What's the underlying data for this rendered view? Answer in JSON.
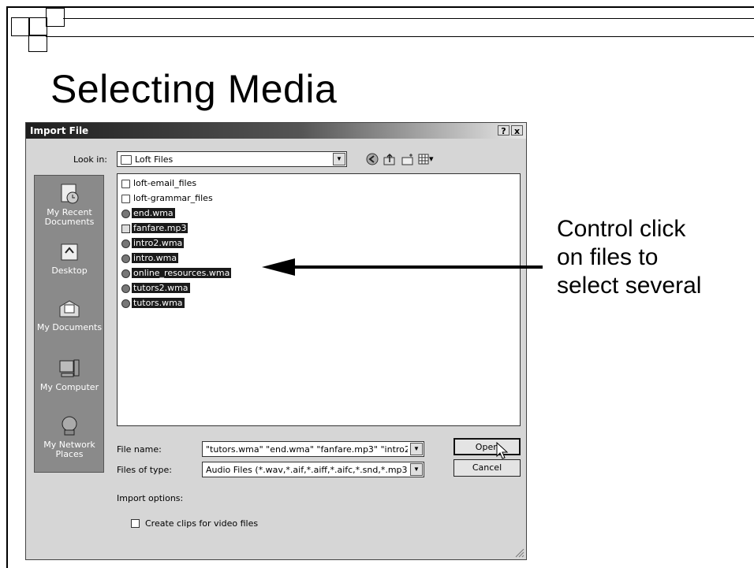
{
  "slide": {
    "title": "Selecting Media",
    "annotation_lines": [
      "Control click",
      "on files to",
      "select several"
    ]
  },
  "dialog": {
    "title": "Import File",
    "help_label": "?",
    "close_label": "x",
    "look_in_label": "Look in:",
    "look_in_value": "Loft Files",
    "toolbar_icons": [
      "back-icon",
      "up-folder-icon",
      "new-folder-icon",
      "views-menu-icon"
    ],
    "places": [
      {
        "label": "My Recent Documents",
        "icon": "recent-documents-icon"
      },
      {
        "label": "Desktop",
        "icon": "desktop-icon"
      },
      {
        "label": "My Documents",
        "icon": "my-documents-icon"
      },
      {
        "label": "My Computer",
        "icon": "my-computer-icon"
      },
      {
        "label": "My Network Places",
        "icon": "network-places-icon"
      }
    ],
    "files": [
      {
        "name": "loft-email_files",
        "type": "folder",
        "selected": false
      },
      {
        "name": "loft-grammar_files",
        "type": "folder",
        "selected": false
      },
      {
        "name": "end.wma",
        "type": "wma",
        "selected": true
      },
      {
        "name": "fanfare.mp3",
        "type": "mp3",
        "selected": true
      },
      {
        "name": "intro2.wma",
        "type": "wma",
        "selected": true
      },
      {
        "name": "intro.wma",
        "type": "wma",
        "selected": true
      },
      {
        "name": "online_resources.wma",
        "type": "wma",
        "selected": true
      },
      {
        "name": "tutors2.wma",
        "type": "wma",
        "selected": true
      },
      {
        "name": "tutors.wma",
        "type": "wma",
        "selected": true
      }
    ],
    "file_name_label": "File name:",
    "file_name_value": "\"tutors.wma\" \"end.wma\" \"fanfare.mp3\" \"intro2.",
    "files_of_type_label": "Files of type:",
    "files_of_type_value": "Audio Files (*.wav,*.aif,*.aiff,*.aifc,*.snd,*.mp3,*.",
    "open_label": "Open",
    "cancel_label": "Cancel",
    "import_options_label": "Import options:",
    "create_clips_label": "Create clips for video files",
    "create_clips_checked": false
  }
}
